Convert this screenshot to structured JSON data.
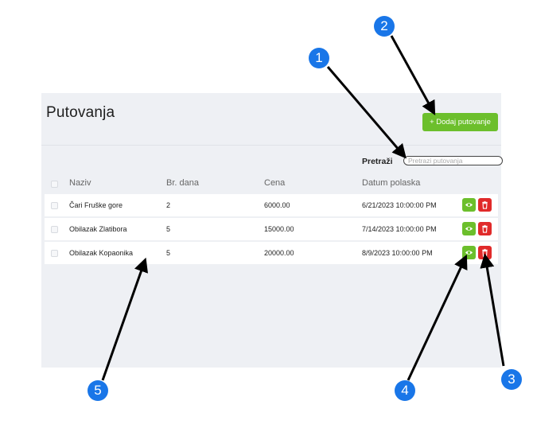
{
  "page": {
    "title": "Putovanja",
    "add_button_label": "+ Dodaj putovanje",
    "search_label": "Pretraži",
    "search_placeholder": "Pretrazi putovanja"
  },
  "table": {
    "headers": [
      "Naziv",
      "Br. dana",
      "Cena",
      "Datum polaska"
    ],
    "rows": [
      {
        "name": "Čari Fruške gore",
        "days": "2",
        "price": "6000.00",
        "date": "6/21/2023 10:00:00 PM"
      },
      {
        "name": "Obilazak Zlatibora",
        "days": "5",
        "price": "15000.00",
        "date": "7/14/2023 10:00:00 PM"
      },
      {
        "name": "Obilazak Kopaonika",
        "days": "5",
        "price": "20000.00",
        "date": "8/9/2023 10:00:00 PM"
      }
    ]
  },
  "annotations": [
    "1",
    "2",
    "3",
    "4",
    "5"
  ],
  "colors": {
    "accent_green": "#6cbf2c",
    "danger_red": "#e02a2a",
    "marker_blue": "#1976e8",
    "panel_bg": "#eef0f4"
  },
  "icons": {
    "view": "eye-icon",
    "delete": "trash-icon"
  }
}
